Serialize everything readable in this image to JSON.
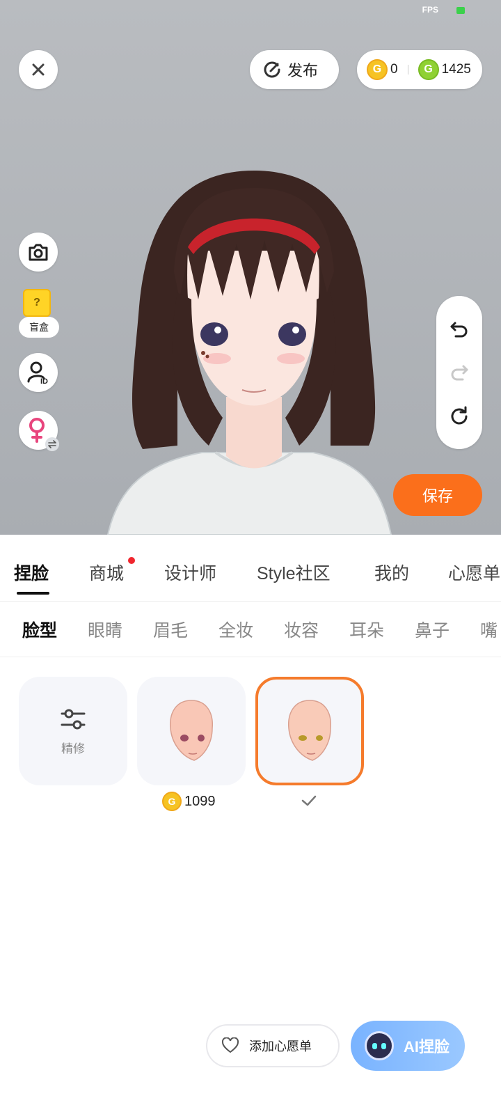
{
  "status": {
    "fps_label": "FPS"
  },
  "top": {
    "publish_label": "发布",
    "gold_coin_count": "0",
    "green_coin_count": "1425"
  },
  "side": {
    "blindbox_label": "盲盒"
  },
  "save_label": "保存",
  "tabs_main": [
    {
      "label": "捏脸",
      "active": true
    },
    {
      "label": "商城",
      "badge": true
    },
    {
      "label": "设计师"
    },
    {
      "label": "Style社区"
    },
    {
      "label": "我的"
    },
    {
      "label": "心愿单"
    }
  ],
  "tabs_sub": [
    {
      "label": "脸型",
      "active": true
    },
    {
      "label": "眼睛"
    },
    {
      "label": "眉毛"
    },
    {
      "label": "全妆"
    },
    {
      "label": "妆容"
    },
    {
      "label": "耳朵"
    },
    {
      "label": "鼻子"
    },
    {
      "label": "嘴"
    }
  ],
  "options": {
    "refine_label": "精修",
    "face1_price": "1099"
  },
  "bottom": {
    "wishlist_label": "添加心愿单",
    "ai_label": "AI捏脸"
  },
  "colors": {
    "accent_orange": "#fb6f1b",
    "selected_border": "#f57b2c",
    "badge_red": "#f0262e",
    "gold_coin": "#f6c323",
    "green_coin": "#8fd133"
  }
}
